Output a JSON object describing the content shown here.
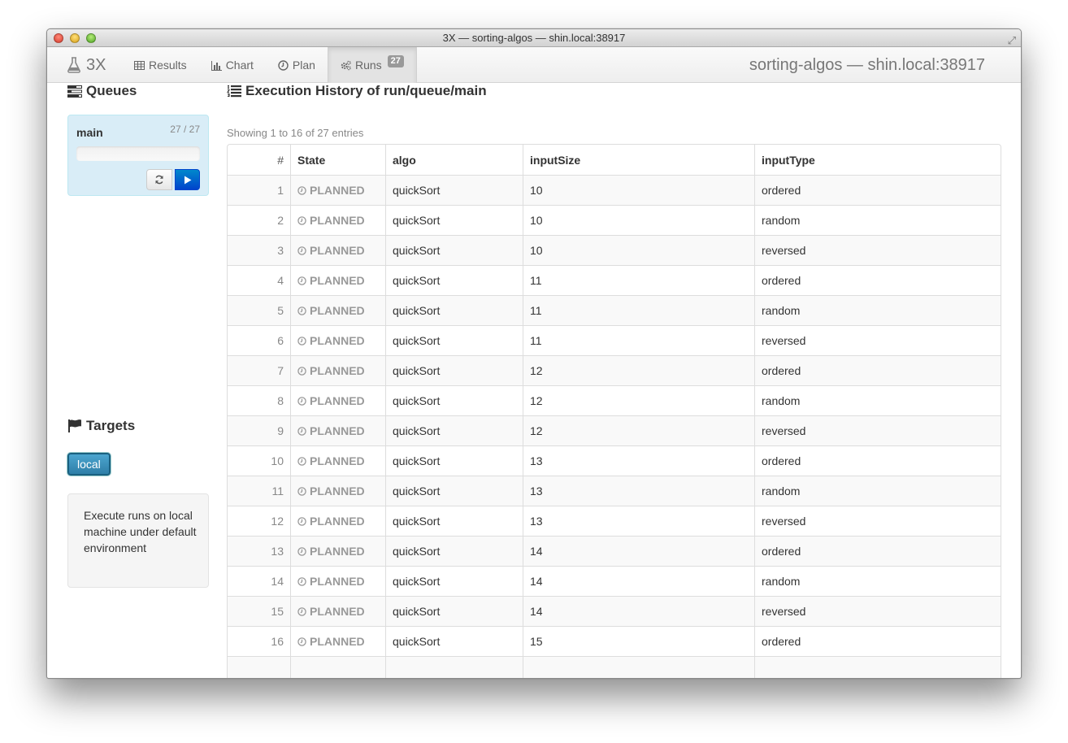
{
  "window": {
    "title": "3X — sorting-algos — shin.local:38917"
  },
  "navbar": {
    "brand": "3X",
    "items": [
      {
        "label": "Results",
        "icon": "table-icon"
      },
      {
        "label": "Chart",
        "icon": "bar-chart-icon"
      },
      {
        "label": "Plan",
        "icon": "clock-icon"
      },
      {
        "label": "Runs",
        "icon": "cogs-icon",
        "badge": "27",
        "active": true
      }
    ],
    "right_text": "sorting-algos — shin.local:38917"
  },
  "sidebar": {
    "queues_title": "Queues",
    "queue": {
      "name": "main",
      "count": "27 / 27",
      "progress": 0.0
    },
    "targets_title": "Targets",
    "target": {
      "label": "local",
      "description": "Execute runs on local machine under default environment"
    }
  },
  "main": {
    "title": "Execution History of run/queue/main",
    "showing": "Showing 1 to 16 of 27 entries",
    "columns": [
      "#",
      "State",
      "algo",
      "inputSize",
      "inputType"
    ],
    "rows": [
      {
        "n": "1",
        "state": "PLANNED",
        "algo": "quickSort",
        "inputSize": "10",
        "inputType": "ordered"
      },
      {
        "n": "2",
        "state": "PLANNED",
        "algo": "quickSort",
        "inputSize": "10",
        "inputType": "random"
      },
      {
        "n": "3",
        "state": "PLANNED",
        "algo": "quickSort",
        "inputSize": "10",
        "inputType": "reversed"
      },
      {
        "n": "4",
        "state": "PLANNED",
        "algo": "quickSort",
        "inputSize": "11",
        "inputType": "ordered"
      },
      {
        "n": "5",
        "state": "PLANNED",
        "algo": "quickSort",
        "inputSize": "11",
        "inputType": "random"
      },
      {
        "n": "6",
        "state": "PLANNED",
        "algo": "quickSort",
        "inputSize": "11",
        "inputType": "reversed"
      },
      {
        "n": "7",
        "state": "PLANNED",
        "algo": "quickSort",
        "inputSize": "12",
        "inputType": "ordered"
      },
      {
        "n": "8",
        "state": "PLANNED",
        "algo": "quickSort",
        "inputSize": "12",
        "inputType": "random"
      },
      {
        "n": "9",
        "state": "PLANNED",
        "algo": "quickSort",
        "inputSize": "12",
        "inputType": "reversed"
      },
      {
        "n": "10",
        "state": "PLANNED",
        "algo": "quickSort",
        "inputSize": "13",
        "inputType": "ordered"
      },
      {
        "n": "11",
        "state": "PLANNED",
        "algo": "quickSort",
        "inputSize": "13",
        "inputType": "random"
      },
      {
        "n": "12",
        "state": "PLANNED",
        "algo": "quickSort",
        "inputSize": "13",
        "inputType": "reversed"
      },
      {
        "n": "13",
        "state": "PLANNED",
        "algo": "quickSort",
        "inputSize": "14",
        "inputType": "ordered"
      },
      {
        "n": "14",
        "state": "PLANNED",
        "algo": "quickSort",
        "inputSize": "14",
        "inputType": "random"
      },
      {
        "n": "15",
        "state": "PLANNED",
        "algo": "quickSort",
        "inputSize": "14",
        "inputType": "reversed"
      },
      {
        "n": "16",
        "state": "PLANNED",
        "algo": "quickSort",
        "inputSize": "15",
        "inputType": "ordered"
      }
    ]
  }
}
